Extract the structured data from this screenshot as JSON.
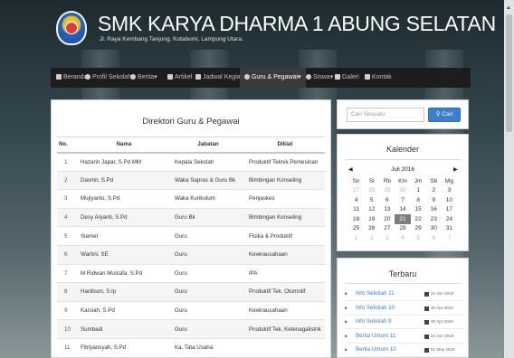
{
  "header": {
    "title": "SMK KARYA DHARMA 1 ABUNG SELATAN",
    "subtitle": "Jl. Raya Kembang Tanjung, Kotabumi, Lampung Utara."
  },
  "nav": {
    "items": [
      {
        "label": "Beranda",
        "icon": "home-icon"
      },
      {
        "label": "Profil Sekolah",
        "icon": "info-icon",
        "caret": "▾"
      },
      {
        "label": "Berita",
        "icon": "info-icon",
        "caret": "▾"
      },
      {
        "label": "Artikel",
        "icon": "list-icon"
      },
      {
        "label": "Jadwal Kegiatan",
        "icon": "list-icon"
      },
      {
        "label": "Guru & Pegawai",
        "icon": "user-icon",
        "caret": "▾",
        "active": true
      },
      {
        "label": "Siswa",
        "icon": "user-icon",
        "caret": "▾"
      },
      {
        "label": "Galeri",
        "icon": "image-icon"
      },
      {
        "label": "Kontak",
        "icon": "contact-icon"
      }
    ]
  },
  "directory": {
    "title": "Direktori Guru & Pegawai",
    "columns": [
      "No.",
      "Nama",
      "Jabatan",
      "Diklat"
    ],
    "rows": [
      [
        "1",
        "Hazarin Japar, S.Pd MM",
        "Kepala Sekolah",
        "Produktif Teknik Pemesinan"
      ],
      [
        "2",
        "Dasmir, S.Pd",
        "Waka Sapras & Guru Bk",
        "Bimbingan Konseling"
      ],
      [
        "3",
        "Mujiyanto, S.Pd",
        "Waka Kurikulum",
        "Penjaskes"
      ],
      [
        "4",
        "Desy Aryanti, S.Pd",
        "Guru Bk",
        "Bimbingan Konseling"
      ],
      [
        "5",
        "Slamet",
        "Guru",
        "Fisika & Produktif"
      ],
      [
        "6",
        "Wartini, SE",
        "Guru",
        "Kewirausahaan"
      ],
      [
        "7",
        "M Ridwan Mustafa, S.Pd",
        "Guru",
        "IPA"
      ],
      [
        "8",
        "Hardison, S.Ip",
        "Guru",
        "Produktif Tek. Otomotif"
      ],
      [
        "9",
        "Karsiah, S.Pd",
        "Guru",
        "Kewirausahaan"
      ],
      [
        "10",
        "Sumbadi",
        "Guru",
        "Produktif Tek. Ketenagalistrik"
      ],
      [
        "11",
        "Fitriyansyah, S.Pd",
        "Ka. Tata Usaha",
        ""
      ]
    ]
  },
  "search": {
    "placeholder": "Cari Sesuatu",
    "button_label": "Cari"
  },
  "calendar": {
    "title": "Kalender",
    "month": "Juli 2016",
    "prev": "◀",
    "next": "▶",
    "days": [
      "Sn",
      "Sl",
      "Rb",
      "Km",
      "Jm",
      "Sb",
      "Mg"
    ],
    "weeks": [
      [
        {
          "d": "27",
          "m": true
        },
        {
          "d": "28",
          "m": true
        },
        {
          "d": "29",
          "m": true
        },
        {
          "d": "30",
          "m": true
        },
        {
          "d": "1"
        },
        {
          "d": "2"
        },
        {
          "d": "3"
        }
      ],
      [
        {
          "d": "4"
        },
        {
          "d": "5"
        },
        {
          "d": "6"
        },
        {
          "d": "7"
        },
        {
          "d": "8"
        },
        {
          "d": "9"
        },
        {
          "d": "10"
        }
      ],
      [
        {
          "d": "11"
        },
        {
          "d": "12"
        },
        {
          "d": "13"
        },
        {
          "d": "14"
        },
        {
          "d": "15"
        },
        {
          "d": "16"
        },
        {
          "d": "17"
        }
      ],
      [
        {
          "d": "18"
        },
        {
          "d": "19"
        },
        {
          "d": "20"
        },
        {
          "d": "21",
          "today": true
        },
        {
          "d": "22"
        },
        {
          "d": "23"
        },
        {
          "d": "24"
        }
      ],
      [
        {
          "d": "25"
        },
        {
          "d": "26"
        },
        {
          "d": "27"
        },
        {
          "d": "28"
        },
        {
          "d": "29"
        },
        {
          "d": "30"
        },
        {
          "d": "31"
        }
      ],
      [
        {
          "d": "1",
          "m": true
        },
        {
          "d": "2",
          "m": true
        },
        {
          "d": "3",
          "m": true
        },
        {
          "d": "4",
          "m": true
        },
        {
          "d": "5",
          "m": true
        },
        {
          "d": "6",
          "m": true
        },
        {
          "d": "7",
          "m": true
        }
      ]
    ]
  },
  "news": {
    "title": "Terbaru",
    "items": [
      {
        "label": "Info Sekolah 11",
        "date": "24 Jun 2016"
      },
      {
        "label": "Info Sekolah 10",
        "date": "30 Apr 2016"
      },
      {
        "label": "Info Sekolah 9",
        "date": "30 Apr 2016"
      },
      {
        "label": "Berita Umum 11",
        "date": "24 Jun 2016"
      },
      {
        "label": "Berita Umum 10",
        "date": "01 May 2016"
      }
    ]
  },
  "colors": {
    "accent": "#3a7fcf",
    "navbar": "#1d1d1d",
    "header_bg": "#1e2b30"
  }
}
